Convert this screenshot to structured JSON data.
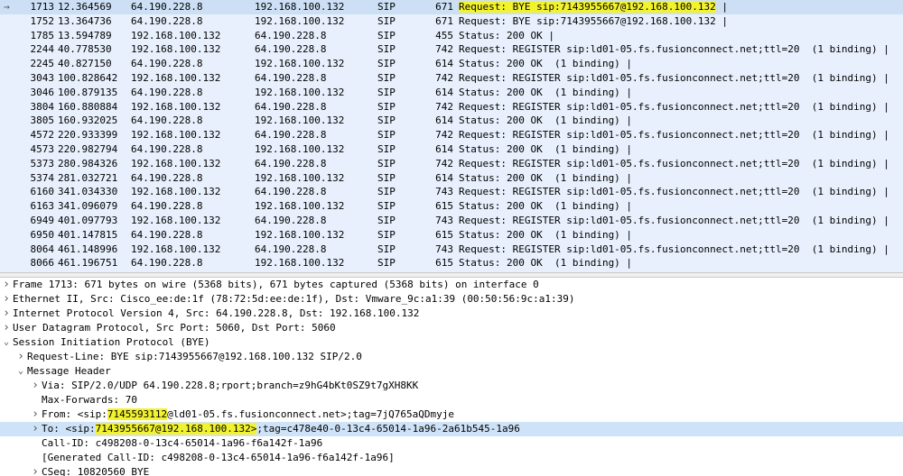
{
  "packet_list": {
    "rows": [
      {
        "arrow": "→",
        "no": "1713",
        "time": "12.364569",
        "src": "64.190.228.8",
        "dst": "192.168.100.132",
        "proto": "SIP",
        "len": "671",
        "info_hl": "Request: BYE sip:7143955667@192.168.100.132",
        "info": " |",
        "selected": true
      },
      {
        "arrow": "",
        "no": "1752",
        "time": "13.364736",
        "src": "64.190.228.8",
        "dst": "192.168.100.132",
        "proto": "SIP",
        "len": "671",
        "info_hl": "",
        "info": "Request: BYE sip:7143955667@192.168.100.132 |",
        "selected": false
      },
      {
        "arrow": "",
        "no": "1785",
        "time": "13.594789",
        "src": "192.168.100.132",
        "dst": "64.190.228.8",
        "proto": "SIP",
        "len": "455",
        "info_hl": "",
        "info": "Status: 200 OK |",
        "selected": false
      },
      {
        "arrow": "",
        "no": "2244",
        "time": "40.778530",
        "src": "192.168.100.132",
        "dst": "64.190.228.8",
        "proto": "SIP",
        "len": "742",
        "info_hl": "",
        "info": "Request: REGISTER sip:ld01-05.fs.fusionconnect.net;ttl=20  (1 binding) |",
        "selected": false
      },
      {
        "arrow": "",
        "no": "2245",
        "time": "40.827150",
        "src": "64.190.228.8",
        "dst": "192.168.100.132",
        "proto": "SIP",
        "len": "614",
        "info_hl": "",
        "info": "Status: 200 OK  (1 binding) |",
        "selected": false
      },
      {
        "arrow": "",
        "no": "3043",
        "time": "100.828642",
        "src": "192.168.100.132",
        "dst": "64.190.228.8",
        "proto": "SIP",
        "len": "742",
        "info_hl": "",
        "info": "Request: REGISTER sip:ld01-05.fs.fusionconnect.net;ttl=20  (1 binding) |",
        "selected": false
      },
      {
        "arrow": "",
        "no": "3046",
        "time": "100.879135",
        "src": "64.190.228.8",
        "dst": "192.168.100.132",
        "proto": "SIP",
        "len": "614",
        "info_hl": "",
        "info": "Status: 200 OK  (1 binding) |",
        "selected": false
      },
      {
        "arrow": "",
        "no": "3804",
        "time": "160.880884",
        "src": "192.168.100.132",
        "dst": "64.190.228.8",
        "proto": "SIP",
        "len": "742",
        "info_hl": "",
        "info": "Request: REGISTER sip:ld01-05.fs.fusionconnect.net;ttl=20  (1 binding) |",
        "selected": false
      },
      {
        "arrow": "",
        "no": "3805",
        "time": "160.932025",
        "src": "64.190.228.8",
        "dst": "192.168.100.132",
        "proto": "SIP",
        "len": "614",
        "info_hl": "",
        "info": "Status: 200 OK  (1 binding) |",
        "selected": false
      },
      {
        "arrow": "",
        "no": "4572",
        "time": "220.933399",
        "src": "192.168.100.132",
        "dst": "64.190.228.8",
        "proto": "SIP",
        "len": "742",
        "info_hl": "",
        "info": "Request: REGISTER sip:ld01-05.fs.fusionconnect.net;ttl=20  (1 binding) |",
        "selected": false
      },
      {
        "arrow": "",
        "no": "4573",
        "time": "220.982794",
        "src": "64.190.228.8",
        "dst": "192.168.100.132",
        "proto": "SIP",
        "len": "614",
        "info_hl": "",
        "info": "Status: 200 OK  (1 binding) |",
        "selected": false
      },
      {
        "arrow": "",
        "no": "5373",
        "time": "280.984326",
        "src": "192.168.100.132",
        "dst": "64.190.228.8",
        "proto": "SIP",
        "len": "742",
        "info_hl": "",
        "info": "Request: REGISTER sip:ld01-05.fs.fusionconnect.net;ttl=20  (1 binding) |",
        "selected": false
      },
      {
        "arrow": "",
        "no": "5374",
        "time": "281.032721",
        "src": "64.190.228.8",
        "dst": "192.168.100.132",
        "proto": "SIP",
        "len": "614",
        "info_hl": "",
        "info": "Status: 200 OK  (1 binding) |",
        "selected": false
      },
      {
        "arrow": "",
        "no": "6160",
        "time": "341.034330",
        "src": "192.168.100.132",
        "dst": "64.190.228.8",
        "proto": "SIP",
        "len": "743",
        "info_hl": "",
        "info": "Request: REGISTER sip:ld01-05.fs.fusionconnect.net;ttl=20  (1 binding) |",
        "selected": false
      },
      {
        "arrow": "",
        "no": "6163",
        "time": "341.096079",
        "src": "64.190.228.8",
        "dst": "192.168.100.132",
        "proto": "SIP",
        "len": "615",
        "info_hl": "",
        "info": "Status: 200 OK  (1 binding) |",
        "selected": false
      },
      {
        "arrow": "",
        "no": "6949",
        "time": "401.097793",
        "src": "192.168.100.132",
        "dst": "64.190.228.8",
        "proto": "SIP",
        "len": "743",
        "info_hl": "",
        "info": "Request: REGISTER sip:ld01-05.fs.fusionconnect.net;ttl=20  (1 binding) |",
        "selected": false
      },
      {
        "arrow": "",
        "no": "6950",
        "time": "401.147815",
        "src": "64.190.228.8",
        "dst": "192.168.100.132",
        "proto": "SIP",
        "len": "615",
        "info_hl": "",
        "info": "Status: 200 OK  (1 binding) |",
        "selected": false
      },
      {
        "arrow": "",
        "no": "8064",
        "time": "461.148996",
        "src": "192.168.100.132",
        "dst": "64.190.228.8",
        "proto": "SIP",
        "len": "743",
        "info_hl": "",
        "info": "Request: REGISTER sip:ld01-05.fs.fusionconnect.net;ttl=20  (1 binding) |",
        "selected": false
      },
      {
        "arrow": "",
        "no": "8066",
        "time": "461.196751",
        "src": "64.190.228.8",
        "dst": "192.168.100.132",
        "proto": "SIP",
        "len": "615",
        "info_hl": "",
        "info": "Status: 200 OK  (1 binding) |",
        "selected": false
      }
    ]
  },
  "packet_details": {
    "rows": [
      {
        "level": 0,
        "twisty": "collapsed",
        "selected": false,
        "segments": [
          {
            "text": "Frame 1713: 671 bytes on wire (5368 bits), 671 bytes captured (5368 bits) on interface 0",
            "hl": false
          }
        ]
      },
      {
        "level": 0,
        "twisty": "collapsed",
        "selected": false,
        "segments": [
          {
            "text": "Ethernet II, Src: Cisco_ee:de:1f (78:72:5d:ee:de:1f), Dst: Vmware_9c:a1:39 (00:50:56:9c:a1:39)",
            "hl": false
          }
        ]
      },
      {
        "level": 0,
        "twisty": "collapsed",
        "selected": false,
        "segments": [
          {
            "text": "Internet Protocol Version 4, Src: 64.190.228.8, Dst: 192.168.100.132",
            "hl": false
          }
        ]
      },
      {
        "level": 0,
        "twisty": "collapsed",
        "selected": false,
        "segments": [
          {
            "text": "User Datagram Protocol, Src Port: 5060, Dst Port: 5060",
            "hl": false
          }
        ]
      },
      {
        "level": 0,
        "twisty": "expanded",
        "selected": false,
        "segments": [
          {
            "text": "Session Initiation Protocol (BYE)",
            "hl": false
          }
        ]
      },
      {
        "level": 1,
        "twisty": "collapsed",
        "selected": false,
        "segments": [
          {
            "text": "Request-Line: BYE sip:7143955667@192.168.100.132 SIP/2.0",
            "hl": false
          }
        ]
      },
      {
        "level": 1,
        "twisty": "expanded",
        "selected": false,
        "segments": [
          {
            "text": "Message Header",
            "hl": false
          }
        ]
      },
      {
        "level": 2,
        "twisty": "collapsed",
        "selected": false,
        "segments": [
          {
            "text": "Via: SIP/2.0/UDP 64.190.228.8;rport;branch=z9hG4bKt0SZ9t7gXH8KK",
            "hl": false
          }
        ]
      },
      {
        "level": 2,
        "twisty": "none",
        "selected": false,
        "segments": [
          {
            "text": "Max-Forwards: 70",
            "hl": false
          }
        ]
      },
      {
        "level": 2,
        "twisty": "collapsed",
        "selected": false,
        "segments": [
          {
            "text": "From: <sip:",
            "hl": false
          },
          {
            "text": "7145593112",
            "hl": true
          },
          {
            "text": "@ld01-05.fs.fusionconnect.net>;tag=7jQ765aQDmyje",
            "hl": false
          }
        ]
      },
      {
        "level": 2,
        "twisty": "collapsed",
        "selected": true,
        "segments": [
          {
            "text": "To: <sip:",
            "hl": false
          },
          {
            "text": "7143955667@192.168.100.132>",
            "hl": true
          },
          {
            "text": ";tag=c478e40-0-13c4-65014-1a96-2a61b545-1a96",
            "hl": false
          }
        ]
      },
      {
        "level": 2,
        "twisty": "none",
        "selected": false,
        "segments": [
          {
            "text": "Call-ID: c498208-0-13c4-65014-1a96-f6a142f-1a96",
            "hl": false
          }
        ]
      },
      {
        "level": 2,
        "twisty": "none",
        "selected": false,
        "segments": [
          {
            "text": "[Generated Call-ID: c498208-0-13c4-65014-1a96-f6a142f-1a96]",
            "hl": false
          }
        ]
      },
      {
        "level": 2,
        "twisty": "collapsed",
        "selected": false,
        "segments": [
          {
            "text": "CSeq: 10820560 BYE",
            "hl": false
          }
        ]
      }
    ]
  }
}
